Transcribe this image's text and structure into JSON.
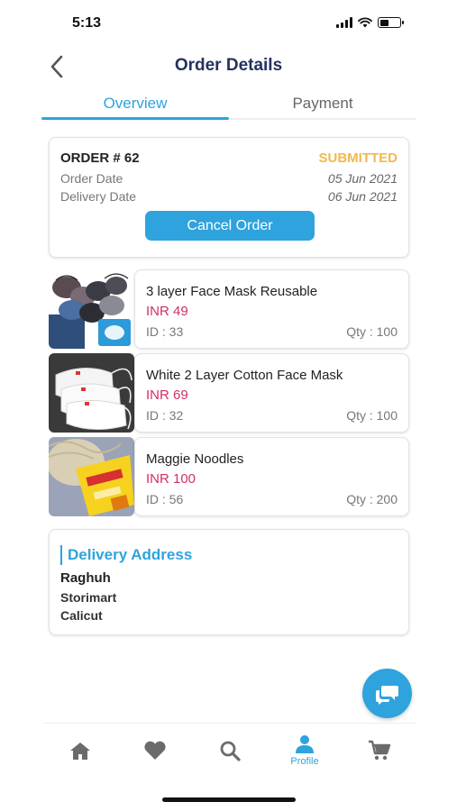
{
  "status_bar": {
    "time": "5:13"
  },
  "header": {
    "title": "Order Details",
    "back_icon": "chevron-left-icon"
  },
  "tabs": [
    {
      "label": "Overview",
      "active": true
    },
    {
      "label": "Payment",
      "active": false
    }
  ],
  "order": {
    "number": "ORDER # 62",
    "status": "SUBMITTED",
    "order_date_label": "Order Date",
    "order_date": "05 Jun 2021",
    "delivery_date_label": "Delivery Date",
    "delivery_date": "06 Jun 2021",
    "cancel_label": "Cancel Order"
  },
  "products": [
    {
      "name": "3 layer Face Mask Reusable",
      "price": "INR 49",
      "id": "ID : 33",
      "qty": "Qty : 100",
      "image": "face-mask-pack-image"
    },
    {
      "name": "White 2 Layer Cotton Face Mask",
      "price": "INR 69",
      "id": "ID : 32",
      "qty": "Qty : 100",
      "image": "white-face-mask-image"
    },
    {
      "name": "Maggie Noodles",
      "price": "INR 100",
      "id": "ID : 56",
      "qty": "Qty : 200",
      "image": "noodles-pack-image"
    }
  ],
  "address": {
    "title": "Delivery Address",
    "name": "Raghuh",
    "line1": "Storimart",
    "line2": "Calicut"
  },
  "bottom_nav": [
    {
      "icon": "home-icon",
      "label": ""
    },
    {
      "icon": "heart-icon",
      "label": ""
    },
    {
      "icon": "search-icon",
      "label": ""
    },
    {
      "icon": "profile-icon",
      "label": "Profile",
      "active": true
    },
    {
      "icon": "cart-icon",
      "label": ""
    }
  ],
  "colors": {
    "accent": "#2ea3dd",
    "title": "#23325f",
    "status_submitted": "#f0b94e",
    "price": "#d02f68",
    "nav_inactive": "#6b6b6b"
  }
}
